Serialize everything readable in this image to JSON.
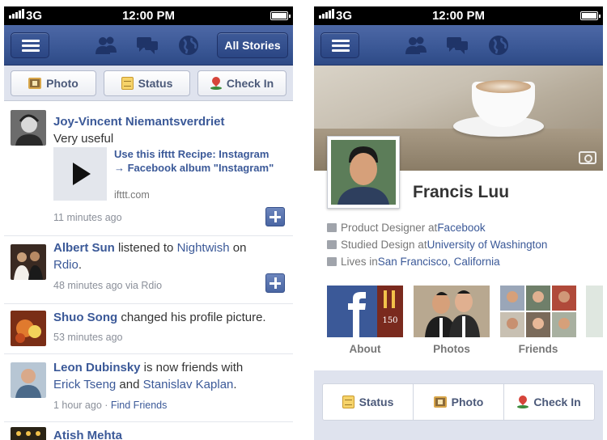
{
  "status_bar": {
    "network": "3G",
    "time": "12:00 PM"
  },
  "left_phone": {
    "navbar": {
      "all_stories_label": "All Stories"
    },
    "publisher": {
      "photo_label": "Photo",
      "status_label": "Status",
      "checkin_label": "Check In"
    },
    "feed": [
      {
        "name": "Joy-Vincent Niemantsverdriet",
        "text": "Very useful",
        "attachment_title": "Use this ifttt Recipe: Instagram → Facebook album \"Instagram\"",
        "attachment_domain": "ifttt.com",
        "time": "11 minutes ago"
      },
      {
        "name": "Albert Sun",
        "action": " listened to ",
        "artist": "Nightwish",
        "on": " on",
        "service": "Rdio",
        "service_end": ".",
        "time": "48 minutes ago via Rdio"
      },
      {
        "name": "Shuo Song",
        "action": " changed his profile picture.",
        "time": "53 minutes ago"
      },
      {
        "name": "Leon Dubinsky",
        "action": " is now friends with",
        "friend1": "Erick Tseng",
        "and": " and ",
        "friend2": "Stanislav Kaplan",
        "end": ".",
        "time": "1 hour ago · ",
        "find_friends": "Find Friends"
      },
      {
        "name": "Atish Mehta"
      }
    ]
  },
  "right_phone": {
    "profile_name": "Francis Luu",
    "about": [
      {
        "prefix": "Product Designer at ",
        "link": "Facebook"
      },
      {
        "prefix": "Studied Design at ",
        "link": "University of Washington"
      },
      {
        "prefix": "Lives in ",
        "link": "San Francisco, California"
      }
    ],
    "tiles": [
      "About",
      "Photos",
      "Friends"
    ],
    "about_tile_text": "150",
    "bottom": {
      "status_label": "Status",
      "photo_label": "Photo",
      "checkin_label": "Check In"
    }
  },
  "colors": {
    "brand_blue": "#3b5998",
    "nav_blue": "#3a5795",
    "publisher_bg": "#dfe3ee"
  }
}
